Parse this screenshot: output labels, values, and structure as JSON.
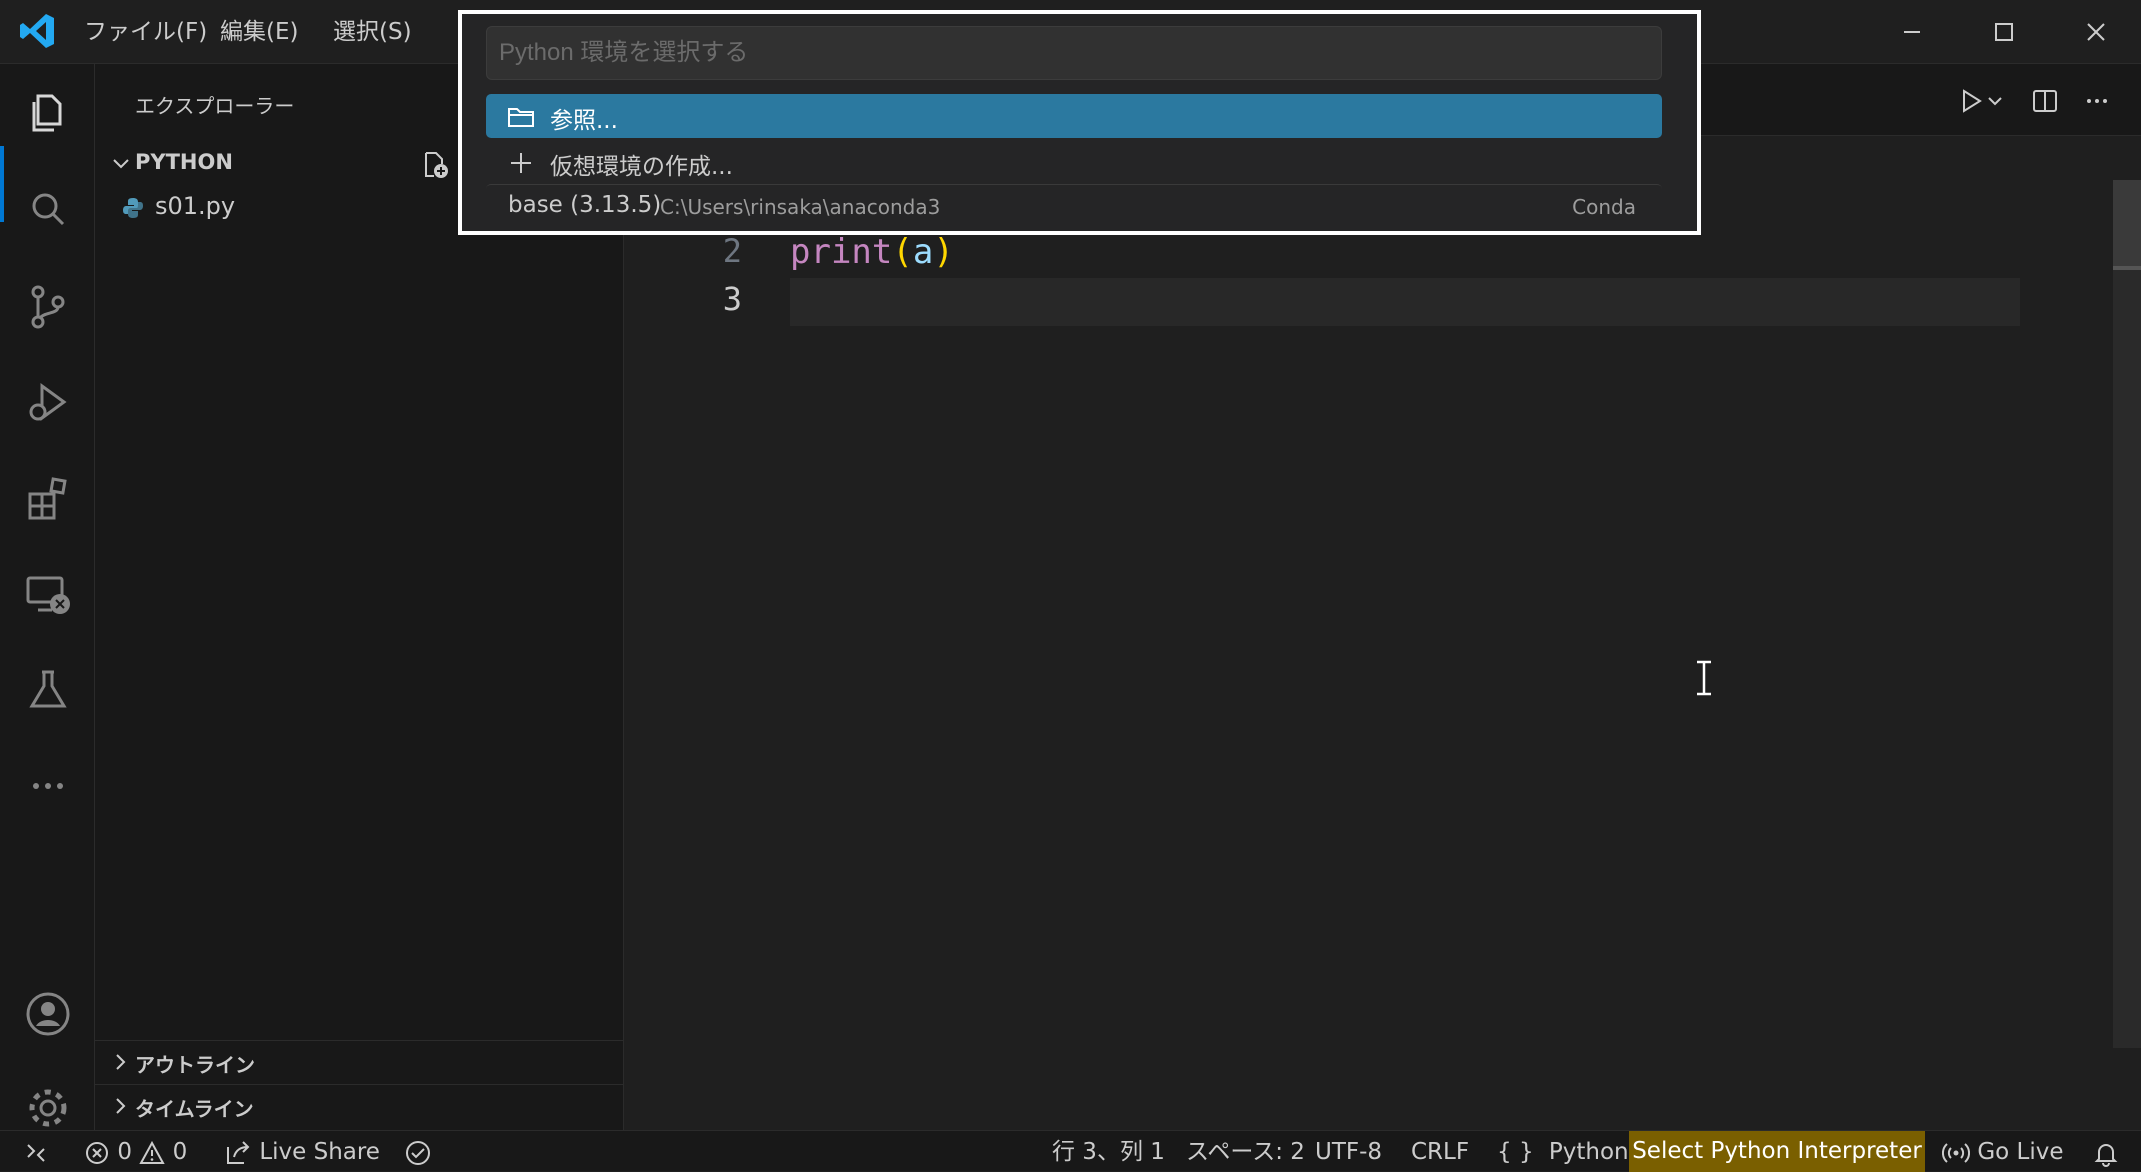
{
  "menu": {
    "file": "ファイル(F)",
    "edit": "編集(E)",
    "selection": "選択(S)"
  },
  "sidebar": {
    "title": "エクスプローラー",
    "folder_name": "PYTHON",
    "files": [
      {
        "name": "s01.py",
        "icon": "python-file-icon"
      }
    ],
    "sections": [
      "アウトライン",
      "タイムライン"
    ]
  },
  "editor": {
    "line_numbers": [
      "2",
      "3"
    ],
    "code": {
      "fn": "print",
      "open_paren": "(",
      "arg": "a",
      "close_paren": ")"
    }
  },
  "quick_pick": {
    "placeholder": "Python 環境を選択する",
    "items": [
      {
        "label": "参照...",
        "icon": "folder-icon",
        "selected": true
      },
      {
        "label": "仮想環境の作成...",
        "icon": "add-icon"
      }
    ],
    "environments": [
      {
        "label": "base (3.13.5)",
        "path": "C:\\Users\\rinsaka\\anaconda3",
        "kind": "Conda"
      }
    ]
  },
  "statusbar": {
    "errors": "0",
    "warnings": "0",
    "live_share": "Live Share",
    "cursor_position": "行 3、列 1",
    "indent": "スペース: 2",
    "encoding": "UTF-8",
    "eol": "CRLF",
    "language_icon": "{ }",
    "language": "Python",
    "interpreter": "Select Python Interpreter",
    "go_live": "Go Live"
  },
  "colors": {
    "accent": "#0078d4",
    "selection": "#2b79a0",
    "interpreter_bg": "#7a5f00"
  }
}
